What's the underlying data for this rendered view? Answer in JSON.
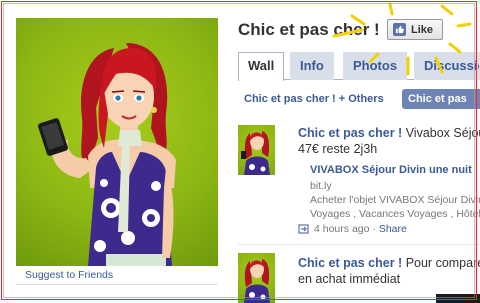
{
  "page": {
    "title": "Chic et pas cher !",
    "like_label": "Like",
    "suggest_label": "Suggest to Friends"
  },
  "tabs": [
    {
      "label": "Wall",
      "active": true
    },
    {
      "label": "Info",
      "active": false
    },
    {
      "label": "Photos",
      "active": false
    },
    {
      "label": "Discussions",
      "active": false
    }
  ],
  "filter": {
    "left_label": "Chic et pas cher ! + Others",
    "active_label": "Chic et pas cher !"
  },
  "posts": [
    {
      "author": "Chic et pas cher !",
      "text_line1": "Vivabox Séjour",
      "text_line2": "47€ reste 2j3h",
      "link_title": "VIVABOX Séjour Divin une nuit",
      "link_domain": "bit.ly",
      "link_desc1": "Acheter l'objet VIVABOX Séjour Divin",
      "link_desc2": "Voyages , Vacances Voyages , Hôtel",
      "time": "4 hours ago",
      "share_label": "Share"
    },
    {
      "author": "Chic et pas cher !",
      "text_line1": "Pour comparer",
      "text_line2": "en achat immédiat"
    }
  ],
  "colors": {
    "facebook_blue": "#3b5998",
    "tab_inactive_bg": "#d8dfea",
    "filter_active_bg": "#6d84b4",
    "profile_bg": "#8db814",
    "frame_red": "#e0312b",
    "sparkle_yellow": "#f2d100"
  },
  "icons": {
    "like": "thumbs-up-icon",
    "post_type": "link-icon"
  }
}
